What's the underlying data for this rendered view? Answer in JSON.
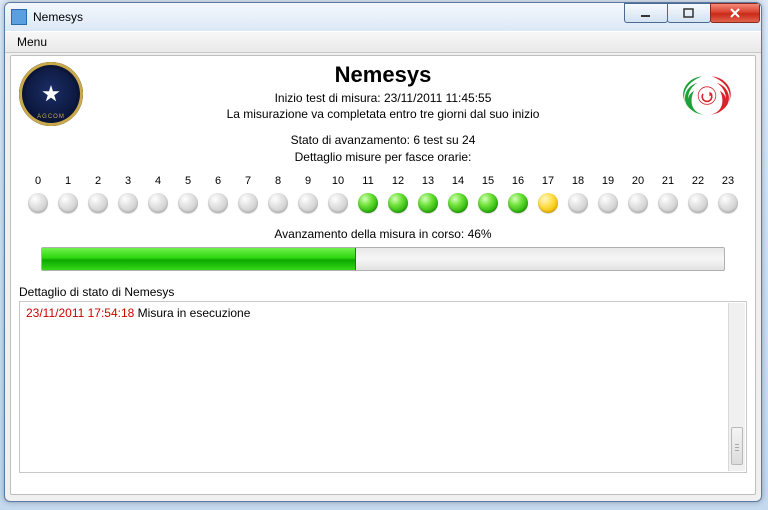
{
  "window": {
    "title": "Nemesys"
  },
  "menubar": {
    "menu": "Menu"
  },
  "header": {
    "app_title": "Nemesys",
    "start_label": "Inizio test di misura: 23/11/2011 11:45:55",
    "deadline_note": "La misurazione va completata entro tre giorni dal suo inizio",
    "progress_state": "Stato di avanzamento: 6 test su 24",
    "hours_heading": "Dettaglio misure per fasce orarie:"
  },
  "hours": {
    "labels": [
      "0",
      "1",
      "2",
      "3",
      "4",
      "5",
      "6",
      "7",
      "8",
      "9",
      "10",
      "11",
      "12",
      "13",
      "14",
      "15",
      "16",
      "17",
      "18",
      "19",
      "20",
      "21",
      "22",
      "23"
    ],
    "states": [
      "off",
      "off",
      "off",
      "off",
      "off",
      "off",
      "off",
      "off",
      "off",
      "off",
      "off",
      "green",
      "green",
      "green",
      "green",
      "green",
      "green",
      "yellow",
      "off",
      "off",
      "off",
      "off",
      "off",
      "off"
    ]
  },
  "progress": {
    "label": "Avanzamento della misura in corso: 46%",
    "percent": 46
  },
  "status": {
    "heading": "Dettaglio di stato di Nemesys",
    "entries": [
      {
        "ts": "23/11/2011 17:54:18",
        "msg": "Misura in esecuzione"
      }
    ]
  }
}
